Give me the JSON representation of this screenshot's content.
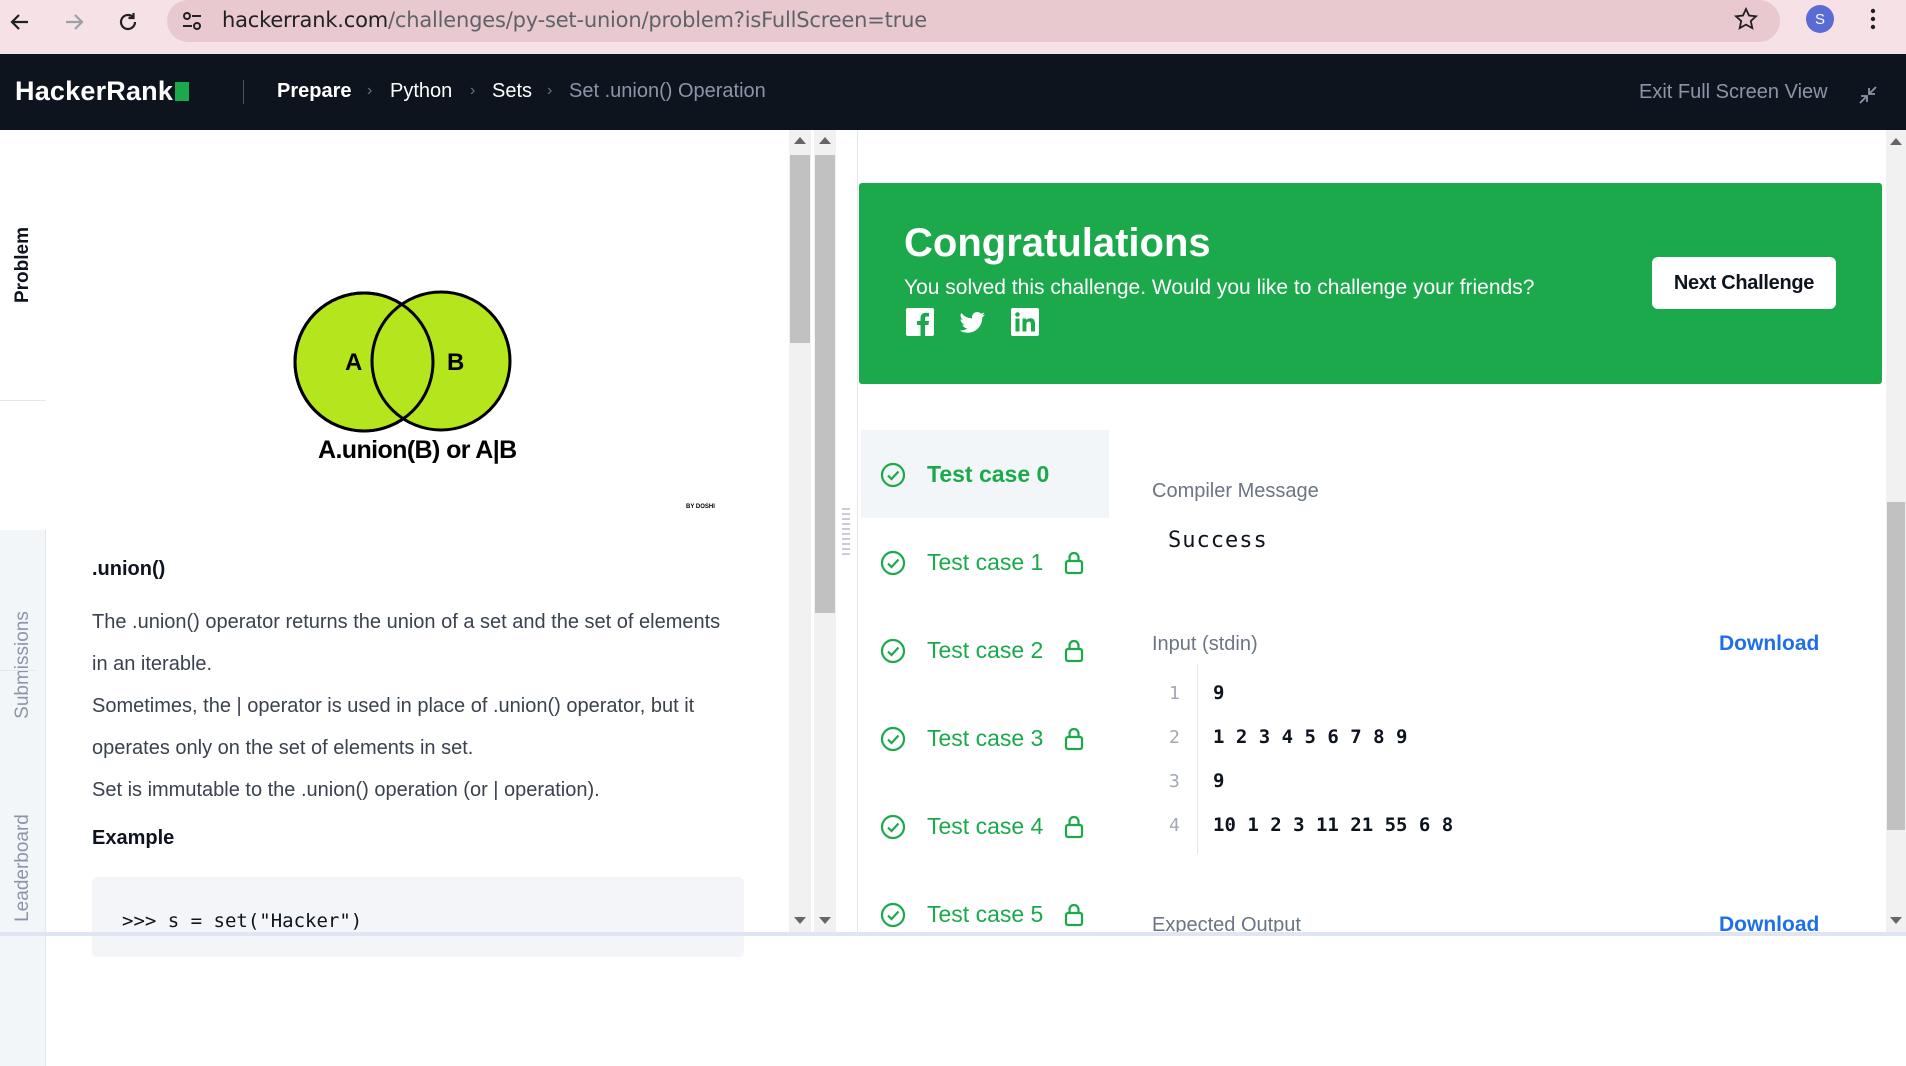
{
  "browser": {
    "url_host": "hackerrank.com",
    "url_path": "/challenges/py-set-union/problem?isFullScreen=true",
    "avatar_letter": "S"
  },
  "header": {
    "logo": "HackerRank",
    "breadcrumbs": [
      "Prepare",
      "Python",
      "Sets",
      "Set .union() Operation"
    ],
    "exit_fullscreen": "Exit Full Screen View"
  },
  "side_tabs": [
    "Problem",
    "Submissions",
    "Leaderboard"
  ],
  "problem": {
    "venn": {
      "left": "A",
      "right": "B",
      "caption": "A.union(B) or A|B",
      "credit": "BY DOSHI",
      "fill_color": "#b5e61d"
    },
    "heading": ".union()",
    "paragraphs": [
      "The .union() operator returns the union of a set and the set of elements",
      "in an iterable.",
      "Sometimes, the | operator is used in place of .union() operator, but it",
      "operates only on the set of elements in set.",
      "Set is immutable to the .union() operation (or | operation)."
    ],
    "example_heading": "Example",
    "code_first_line": ">>> s = set(\"Hacker\")"
  },
  "result": {
    "title": "Congratulations",
    "subtitle": "You solved this challenge. Would you like to challenge your friends?",
    "next_button": "Next Challenge",
    "social_icons": [
      "facebook-icon",
      "twitter-icon",
      "linkedin-icon"
    ],
    "accent_color": "#1ba94c",
    "test_cases": [
      {
        "label": "Test case 0",
        "locked": false,
        "active": true
      },
      {
        "label": "Test case 1",
        "locked": true,
        "active": false
      },
      {
        "label": "Test case 2",
        "locked": true,
        "active": false
      },
      {
        "label": "Test case 3",
        "locked": true,
        "active": false
      },
      {
        "label": "Test case 4",
        "locked": true,
        "active": false
      },
      {
        "label": "Test case 5",
        "locked": true,
        "active": false
      }
    ],
    "compiler_label": "Compiler Message",
    "compiler_message": "Success",
    "input_label": "Input (stdin)",
    "download_label": "Download",
    "input_lines": [
      {
        "n": "1",
        "text": "9"
      },
      {
        "n": "2",
        "text": "1 2 3 4 5 6 7 8 9"
      },
      {
        "n": "3",
        "text": "9"
      },
      {
        "n": "4",
        "text": "10 1 2 3 11 21 55 6 8"
      }
    ],
    "expected_label": "Expected Output",
    "expected_download": "Download"
  }
}
